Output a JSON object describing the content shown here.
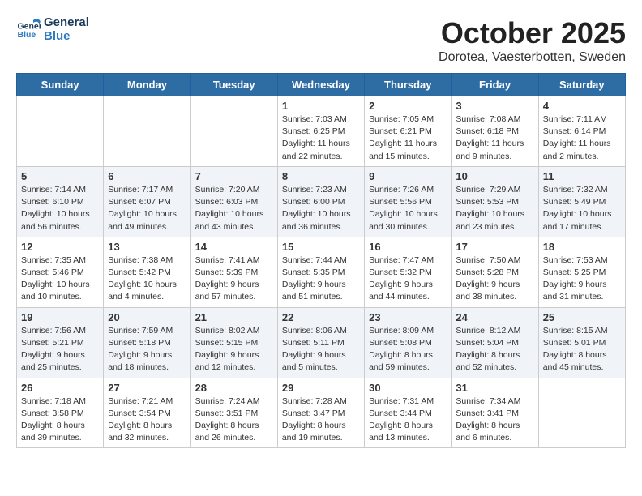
{
  "header": {
    "logo_line1": "General",
    "logo_line2": "Blue",
    "month": "October 2025",
    "location": "Dorotea, Vaesterbotten, Sweden"
  },
  "days_of_week": [
    "Sunday",
    "Monday",
    "Tuesday",
    "Wednesday",
    "Thursday",
    "Friday",
    "Saturday"
  ],
  "weeks": [
    [
      {
        "day": "",
        "info": ""
      },
      {
        "day": "",
        "info": ""
      },
      {
        "day": "",
        "info": ""
      },
      {
        "day": "1",
        "info": "Sunrise: 7:03 AM\nSunset: 6:25 PM\nDaylight: 11 hours\nand 22 minutes."
      },
      {
        "day": "2",
        "info": "Sunrise: 7:05 AM\nSunset: 6:21 PM\nDaylight: 11 hours\nand 15 minutes."
      },
      {
        "day": "3",
        "info": "Sunrise: 7:08 AM\nSunset: 6:18 PM\nDaylight: 11 hours\nand 9 minutes."
      },
      {
        "day": "4",
        "info": "Sunrise: 7:11 AM\nSunset: 6:14 PM\nDaylight: 11 hours\nand 2 minutes."
      }
    ],
    [
      {
        "day": "5",
        "info": "Sunrise: 7:14 AM\nSunset: 6:10 PM\nDaylight: 10 hours\nand 56 minutes."
      },
      {
        "day": "6",
        "info": "Sunrise: 7:17 AM\nSunset: 6:07 PM\nDaylight: 10 hours\nand 49 minutes."
      },
      {
        "day": "7",
        "info": "Sunrise: 7:20 AM\nSunset: 6:03 PM\nDaylight: 10 hours\nand 43 minutes."
      },
      {
        "day": "8",
        "info": "Sunrise: 7:23 AM\nSunset: 6:00 PM\nDaylight: 10 hours\nand 36 minutes."
      },
      {
        "day": "9",
        "info": "Sunrise: 7:26 AM\nSunset: 5:56 PM\nDaylight: 10 hours\nand 30 minutes."
      },
      {
        "day": "10",
        "info": "Sunrise: 7:29 AM\nSunset: 5:53 PM\nDaylight: 10 hours\nand 23 minutes."
      },
      {
        "day": "11",
        "info": "Sunrise: 7:32 AM\nSunset: 5:49 PM\nDaylight: 10 hours\nand 17 minutes."
      }
    ],
    [
      {
        "day": "12",
        "info": "Sunrise: 7:35 AM\nSunset: 5:46 PM\nDaylight: 10 hours\nand 10 minutes."
      },
      {
        "day": "13",
        "info": "Sunrise: 7:38 AM\nSunset: 5:42 PM\nDaylight: 10 hours\nand 4 minutes."
      },
      {
        "day": "14",
        "info": "Sunrise: 7:41 AM\nSunset: 5:39 PM\nDaylight: 9 hours\nand 57 minutes."
      },
      {
        "day": "15",
        "info": "Sunrise: 7:44 AM\nSunset: 5:35 PM\nDaylight: 9 hours\nand 51 minutes."
      },
      {
        "day": "16",
        "info": "Sunrise: 7:47 AM\nSunset: 5:32 PM\nDaylight: 9 hours\nand 44 minutes."
      },
      {
        "day": "17",
        "info": "Sunrise: 7:50 AM\nSunset: 5:28 PM\nDaylight: 9 hours\nand 38 minutes."
      },
      {
        "day": "18",
        "info": "Sunrise: 7:53 AM\nSunset: 5:25 PM\nDaylight: 9 hours\nand 31 minutes."
      }
    ],
    [
      {
        "day": "19",
        "info": "Sunrise: 7:56 AM\nSunset: 5:21 PM\nDaylight: 9 hours\nand 25 minutes."
      },
      {
        "day": "20",
        "info": "Sunrise: 7:59 AM\nSunset: 5:18 PM\nDaylight: 9 hours\nand 18 minutes."
      },
      {
        "day": "21",
        "info": "Sunrise: 8:02 AM\nSunset: 5:15 PM\nDaylight: 9 hours\nand 12 minutes."
      },
      {
        "day": "22",
        "info": "Sunrise: 8:06 AM\nSunset: 5:11 PM\nDaylight: 9 hours\nand 5 minutes."
      },
      {
        "day": "23",
        "info": "Sunrise: 8:09 AM\nSunset: 5:08 PM\nDaylight: 8 hours\nand 59 minutes."
      },
      {
        "day": "24",
        "info": "Sunrise: 8:12 AM\nSunset: 5:04 PM\nDaylight: 8 hours\nand 52 minutes."
      },
      {
        "day": "25",
        "info": "Sunrise: 8:15 AM\nSunset: 5:01 PM\nDaylight: 8 hours\nand 45 minutes."
      }
    ],
    [
      {
        "day": "26",
        "info": "Sunrise: 7:18 AM\nSunset: 3:58 PM\nDaylight: 8 hours\nand 39 minutes."
      },
      {
        "day": "27",
        "info": "Sunrise: 7:21 AM\nSunset: 3:54 PM\nDaylight: 8 hours\nand 32 minutes."
      },
      {
        "day": "28",
        "info": "Sunrise: 7:24 AM\nSunset: 3:51 PM\nDaylight: 8 hours\nand 26 minutes."
      },
      {
        "day": "29",
        "info": "Sunrise: 7:28 AM\nSunset: 3:47 PM\nDaylight: 8 hours\nand 19 minutes."
      },
      {
        "day": "30",
        "info": "Sunrise: 7:31 AM\nSunset: 3:44 PM\nDaylight: 8 hours\nand 13 minutes."
      },
      {
        "day": "31",
        "info": "Sunrise: 7:34 AM\nSunset: 3:41 PM\nDaylight: 8 hours\nand 6 minutes."
      },
      {
        "day": "",
        "info": ""
      }
    ]
  ]
}
